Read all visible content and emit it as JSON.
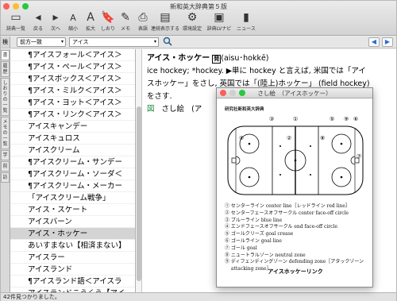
{
  "window": {
    "title": "新和英大辞典第５版",
    "traffic_colors": [
      "#fe5f57",
      "#febc2e",
      "#28c840"
    ]
  },
  "toolbar": [
    {
      "icon": "dictionary-list-icon",
      "glyph": "▭",
      "label": "辞典一覧"
    },
    {
      "icon": "back-arrow-icon",
      "glyph": "◂",
      "label": "戻る"
    },
    {
      "icon": "forward-arrow-icon",
      "glyph": "▸",
      "label": "次へ"
    },
    {
      "icon": "font-smaller-icon",
      "glyph": "A",
      "label": "縮小"
    },
    {
      "icon": "font-larger-icon",
      "glyph": "A",
      "label": "拡大"
    },
    {
      "icon": "bookmark-icon",
      "glyph": "🔖",
      "label": "しおり"
    },
    {
      "icon": "memo-icon",
      "glyph": "✎",
      "label": "メモ"
    },
    {
      "icon": "print-icon",
      "glyph": "⎙",
      "label": "表語"
    },
    {
      "icon": "continuous-display-icon",
      "glyph": "▤",
      "label": "連続表示する"
    },
    {
      "icon": "settings-icon",
      "glyph": "⚙",
      "label": "環境設定"
    },
    {
      "icon": "lv-navi-icon",
      "glyph": "▣",
      "label": "辞典LVナビ"
    },
    {
      "icon": "news-icon",
      "glyph": "▮",
      "label": "ニュース"
    }
  ],
  "search": {
    "tab_label": "検",
    "mode": "前方一致",
    "query": "アイス"
  },
  "side_tabs": [
    "書",
    "履歴",
    "しおりの一覧",
    "メモの一覧",
    "学",
    "前",
    "訪"
  ],
  "list": {
    "items": [
      "¶アイスフォール＜アイス＞",
      "¶アイス・ペール＜アイス＞",
      "¶アイスボックス＜アイス＞",
      "¶アイス・ミルク＜アイス＞",
      "¶アイス・ヨット＜アイス＞",
      "¶アイス・リンク＜アイス＞",
      "アイスキャンデー",
      "アイスキュロス",
      "アイスクリーム",
      "¶アイスクリーム・サンデー",
      "¶アイスクリーム・ソーダ＜",
      "¶アイスクリーム・メーカー",
      "「アイスクリーム戦争」",
      "アイス・スケート",
      "アイスバーン",
      "アイス・ホッケー",
      "あいすまない【相済まない】",
      "アイスラー",
      "アイスランド",
      "¶アイスランド語＜アイスラ",
      "アイスランドこうくう【アイ"
    ],
    "selected_index": 15
  },
  "article": {
    "headword": "アイス・ホッケー",
    "pron_badge": "発",
    "pronunciation": "(aisu･hokkē)",
    "line1": "ice hockey; *hockey. ▶単に hockey と言えば, 米国では「アイ",
    "line2": "スホッケー」をさし, 英国では「(陸上)ホッケー」 (field hockey)",
    "line3": "をさす.",
    "figure_mark": "図",
    "figure_link": "さし絵",
    "figure_paren": "(ア"
  },
  "status": "42件見つかりました。",
  "popup": {
    "title": "さし絵　（アイスホッケー）",
    "publisher": "研究社新和英大辞典",
    "legend": [
      "① センターライン center line［レッドライン red line］",
      "② センターフェースオフサークル center face-off circle",
      "③ ブルーライン blue line",
      "④ エンドフェースオフサークル end face-off circle",
      "⑤ ゴールクリーズ goal crease",
      "⑥ ゴールライン goal line",
      "⑦ ゴール goal",
      "⑧ ニュートラルゾーン neutral zone",
      "⑨ ディフェンディングゾーン defending zone［アタックゾーン",
      "　 attacking zone］"
    ],
    "fig_title": "アイスホッケーリンク",
    "rink_numbers": [
      "①",
      "②",
      "③",
      "④",
      "⑤",
      "⑥",
      "⑦",
      "⑧",
      "⑨"
    ]
  }
}
